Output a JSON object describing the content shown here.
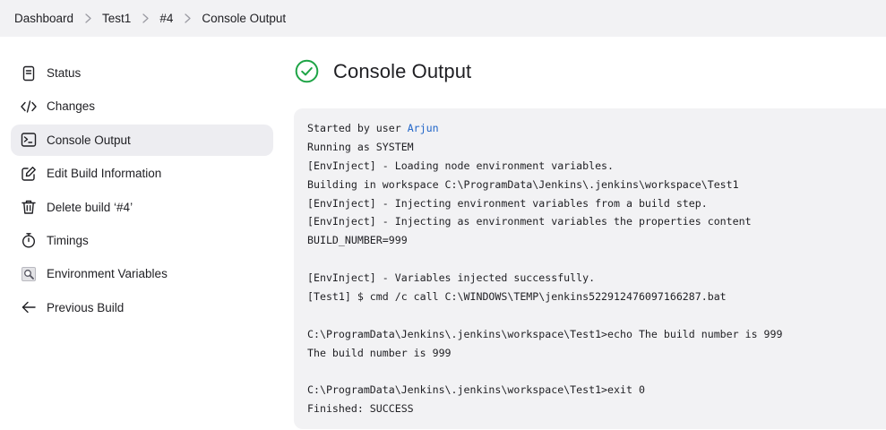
{
  "breadcrumb": {
    "items": [
      "Dashboard",
      "Test1",
      "#4",
      "Console Output"
    ]
  },
  "sidebar": {
    "items": [
      {
        "label": "Status",
        "icon": "status-icon",
        "active": false
      },
      {
        "label": "Changes",
        "icon": "code-icon",
        "active": false
      },
      {
        "label": "Console Output",
        "icon": "terminal-icon",
        "active": true
      },
      {
        "label": "Edit Build Information",
        "icon": "edit-icon",
        "active": false
      },
      {
        "label": "Delete build ‘#4’",
        "icon": "trash-icon",
        "active": false
      },
      {
        "label": "Timings",
        "icon": "stopwatch-icon",
        "active": false
      },
      {
        "label": "Environment Variables",
        "icon": "env-vars-icon",
        "active": false
      },
      {
        "label": "Previous Build",
        "icon": "arrow-left-icon",
        "active": false
      }
    ]
  },
  "page": {
    "title": "Console Output",
    "status_icon": "success-check-icon"
  },
  "console": {
    "started_prefix": "Started by user ",
    "user": "Arjun",
    "lines": [
      "Running as SYSTEM",
      "[EnvInject] - Loading node environment variables.",
      "Building in workspace C:\\ProgramData\\Jenkins\\.jenkins\\workspace\\Test1",
      "[EnvInject] - Injecting environment variables from a build step.",
      "[EnvInject] - Injecting as environment variables the properties content",
      "BUILD_NUMBER=999",
      "",
      "[EnvInject] - Variables injected successfully.",
      "[Test1] $ cmd /c call C:\\WINDOWS\\TEMP\\jenkins522912476097166287.bat",
      "",
      "C:\\ProgramData\\Jenkins\\.jenkins\\workspace\\Test1>echo The build number is 999",
      "The build number is 999",
      "",
      "C:\\ProgramData\\Jenkins\\.jenkins\\workspace\\Test1>exit 0",
      "Finished: SUCCESS"
    ]
  },
  "colors": {
    "success": "#1ea446",
    "link": "#1f64c8",
    "panel_bg": "#f2f2f4",
    "active_item_bg": "#ededf1"
  }
}
